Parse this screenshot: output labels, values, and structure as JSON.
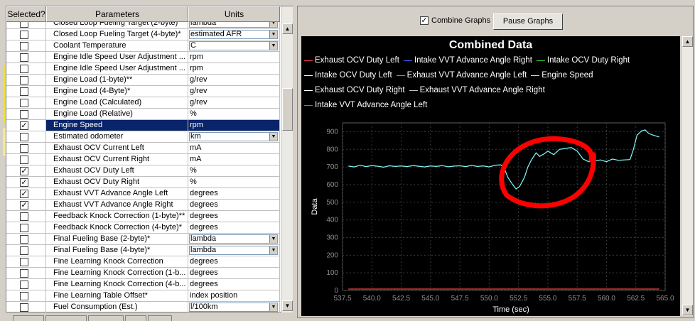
{
  "params": {
    "headers": {
      "selected": "Selected?",
      "parameters": "Parameters",
      "units": "Units"
    },
    "rows": [
      {
        "name": "Closed Loop Fueling Target (2-byte)",
        "unit": "lambda",
        "checked": false,
        "combo": true,
        "partial": true
      },
      {
        "name": "Closed Loop Fueling Target (4-byte)*",
        "unit": "estimated AFR",
        "checked": false,
        "combo": true
      },
      {
        "name": "Coolant Temperature",
        "unit": "C",
        "checked": false,
        "combo": true
      },
      {
        "name": "Engine Idle Speed User Adjustment ...",
        "unit": "rpm",
        "checked": false
      },
      {
        "name": "Engine Idle Speed User Adjustment ...",
        "unit": "rpm",
        "checked": false
      },
      {
        "name": "Engine Load (1-byte)**",
        "unit": "g/rev",
        "checked": false
      },
      {
        "name": "Engine Load (4-Byte)*",
        "unit": "g/rev",
        "checked": false
      },
      {
        "name": "Engine Load (Calculated)",
        "unit": "g/rev",
        "checked": false
      },
      {
        "name": "Engine Load (Relative)",
        "unit": "%",
        "checked": false
      },
      {
        "name": "Engine Speed",
        "unit": "rpm",
        "checked": true,
        "selected": true
      },
      {
        "name": "Estimated odometer",
        "unit": "km",
        "checked": false,
        "combo": true
      },
      {
        "name": "Exhaust OCV Current Left",
        "unit": "mA",
        "checked": false
      },
      {
        "name": "Exhaust OCV Current Right",
        "unit": "mA",
        "checked": false
      },
      {
        "name": "Exhaust OCV Duty Left",
        "unit": "%",
        "checked": true
      },
      {
        "name": "Exhaust OCV Duty Right",
        "unit": "%",
        "checked": true
      },
      {
        "name": "Exhaust VVT Advance Angle Left",
        "unit": "degrees",
        "checked": true
      },
      {
        "name": "Exhaust VVT Advance Angle Right",
        "unit": "degrees",
        "checked": true
      },
      {
        "name": "Feedback Knock Correction (1-byte)**",
        "unit": "degrees",
        "checked": false
      },
      {
        "name": "Feedback Knock Correction (4-byte)*",
        "unit": "degrees",
        "checked": false
      },
      {
        "name": "Final Fueling Base (2-byte)*",
        "unit": "lambda",
        "checked": false,
        "combo": true
      },
      {
        "name": "Final Fueling Base (4-byte)*",
        "unit": "lambda",
        "checked": false,
        "combo": true
      },
      {
        "name": "Fine Learning Knock Correction",
        "unit": "degrees",
        "checked": false
      },
      {
        "name": "Fine Learning Knock Correction (1-b...",
        "unit": "degrees",
        "checked": false
      },
      {
        "name": "Fine Learning Knock Correction (4-b...",
        "unit": "degrees",
        "checked": false
      },
      {
        "name": "Fine Learning Table Offset*",
        "unit": "index position",
        "checked": false
      },
      {
        "name": "Fuel Consumption (Est.)",
        "unit": "l/100km",
        "checked": false,
        "combo": true
      },
      {
        "name": "Fuel Consumption (Est.)",
        "unit": "",
        "checked": false,
        "partial": true
      }
    ]
  },
  "graph_panel": {
    "combine_label": "Combine Graphs",
    "combine_checked": true,
    "pause_label": "Pause Graphs"
  },
  "chart_data": {
    "type": "line",
    "title": "Combined Data",
    "xlabel": "Time (sec)",
    "ylabel": "Data",
    "xlim": [
      537.5,
      565.0
    ],
    "ylim": [
      0,
      950
    ],
    "x_ticks": [
      "537.5",
      "540.0",
      "542.5",
      "545.0",
      "547.5",
      "550.0",
      "552.5",
      "555.0",
      "557.5",
      "560.0",
      "562.5",
      "565.0"
    ],
    "y_ticks": [
      "0",
      "100",
      "200",
      "300",
      "400",
      "500",
      "600",
      "700",
      "800",
      "900"
    ],
    "grid": true,
    "legend_rows": [
      [
        {
          "name": "Exhaust OCV Duty Left",
          "color": "#ff4040"
        },
        {
          "name": "Intake VVT Advance Angle Right",
          "color": "#4060ff"
        },
        {
          "name": "Intake OCV Duty Right",
          "color": "#30d030"
        }
      ],
      [
        {
          "name": "Intake OCV Duty Left",
          "color": "#ffffff"
        },
        {
          "name": "Exhaust VVT Advance Angle Left",
          "color": "#ff40ff"
        },
        {
          "name": "Engine Speed",
          "color": "#80ffff"
        }
      ],
      [
        {
          "name": "Exhaust OCV Duty Right",
          "color": "#ffffff"
        },
        {
          "name": "Exhaust VVT Advance Angle Right",
          "color": "#c0c0c0"
        }
      ],
      [
        {
          "name": "Intake VVT Advance Angle Left",
          "color": "#ff4040"
        }
      ]
    ],
    "series": [
      {
        "name": "Engine Speed",
        "color": "#80ffff",
        "x": [
          538.0,
          538.5,
          539.0,
          539.5,
          540.0,
          540.5,
          541.0,
          541.5,
          542.0,
          542.5,
          543.0,
          543.5,
          544.0,
          544.5,
          545.0,
          545.5,
          546.0,
          546.5,
          547.0,
          547.5,
          548.0,
          548.5,
          549.0,
          549.5,
          550.0,
          550.5,
          551.0,
          551.3,
          551.6,
          552.0,
          552.3,
          552.6,
          553.0,
          553.3,
          553.6,
          554.0,
          554.3,
          554.7,
          555.0,
          555.5,
          556.0,
          556.5,
          557.0,
          557.5,
          558.0,
          558.5,
          559.0,
          559.5,
          560.0,
          560.5,
          561.0,
          561.5,
          562.0,
          562.3,
          562.6,
          563.0,
          563.3,
          563.6,
          564.0,
          564.5
        ],
        "y": [
          705,
          700,
          710,
          702,
          708,
          704,
          699,
          707,
          703,
          706,
          702,
          708,
          704,
          700,
          706,
          703,
          708,
          701,
          705,
          707,
          702,
          709,
          703,
          706,
          700,
          710,
          712,
          690,
          640,
          600,
          575,
          590,
          640,
          700,
          740,
          780,
          760,
          775,
          790,
          770,
          800,
          805,
          810,
          790,
          745,
          730,
          735,
          740,
          730,
          745,
          738,
          740,
          742,
          800,
          880,
          905,
          910,
          890,
          880,
          870
        ]
      },
      {
        "name": "Exhaust OCV Duty Left",
        "color": "#ff4040",
        "x": [
          538.0,
          564.5
        ],
        "y": [
          8,
          8
        ]
      }
    ],
    "annotation": {
      "type": "hand-drawn red circle",
      "color": "#ff0000"
    }
  }
}
